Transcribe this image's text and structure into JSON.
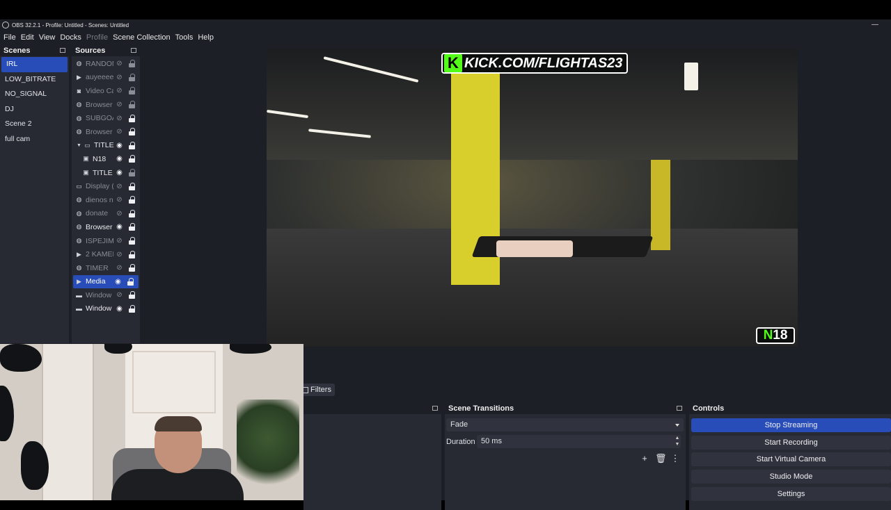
{
  "window": {
    "title": "OBS 32.2.1 - Profile: Untitled - Scenes: Untitled"
  },
  "menu": [
    "File",
    "Edit",
    "View",
    "Docks",
    "Profile",
    "Scene Collection",
    "Tools",
    "Help"
  ],
  "scenes": {
    "header": "Scenes",
    "items": [
      "IRL",
      "LOW_BITRATE",
      "NO_SIGNAL",
      "DJ",
      "Scene 2",
      "full cam"
    ],
    "selected": "IRL"
  },
  "sources": {
    "header": "Sources",
    "items": [
      {
        "name": "RANDOM",
        "icon": "globe-icon",
        "visible": false,
        "locked": false
      },
      {
        "name": "auyeeee",
        "icon": "play-icon",
        "visible": false,
        "locked": false
      },
      {
        "name": "Video Ca",
        "icon": "camera-icon",
        "visible": false,
        "locked": false
      },
      {
        "name": "Browser",
        "icon": "globe-icon",
        "visible": false,
        "locked": false
      },
      {
        "name": "SUBGOA",
        "icon": "globe-icon",
        "visible": false,
        "locked": true
      },
      {
        "name": "Browser",
        "icon": "globe-icon",
        "visible": false,
        "locked": true
      },
      {
        "name": "TITLE",
        "icon": "folder-icon",
        "visible": true,
        "locked": true,
        "expanded": true
      },
      {
        "name": "N18",
        "icon": "image-icon",
        "visible": true,
        "locked": true,
        "child": true
      },
      {
        "name": "TITLE",
        "icon": "image-icon",
        "visible": true,
        "locked": false,
        "child": true
      },
      {
        "name": "Display (",
        "icon": "monitor-icon",
        "visible": false,
        "locked": true
      },
      {
        "name": "dienos n",
        "icon": "globe-icon",
        "visible": false,
        "locked": true
      },
      {
        "name": "donate",
        "icon": "globe-icon",
        "visible": false,
        "locked": true
      },
      {
        "name": "Browser",
        "icon": "globe-icon",
        "visible": true,
        "locked": true
      },
      {
        "name": "ISPEJIMA",
        "icon": "globe-icon",
        "visible": false,
        "locked": true
      },
      {
        "name": "2 KAMEF",
        "icon": "play-icon",
        "visible": false,
        "locked": true
      },
      {
        "name": "TIMER",
        "icon": "globe-icon",
        "visible": false,
        "locked": true
      },
      {
        "name": "Media",
        "icon": "play-icon",
        "visible": true,
        "locked": true,
        "selected": true
      },
      {
        "name": "Window",
        "icon": "window-icon",
        "visible": false,
        "locked": true
      },
      {
        "name": "Window",
        "icon": "window-icon",
        "visible": true,
        "locked": true
      }
    ]
  },
  "preview": {
    "banner_text": "KICK.COM/FLIGHTAS23",
    "banner_k": "K",
    "badge_n": "N",
    "badge_num": "18"
  },
  "filters": {
    "label": "Filters"
  },
  "transitions": {
    "header": "Scene Transitions",
    "selected": "Fade",
    "duration_label": "Duration",
    "duration_value": "50 ms"
  },
  "controls": {
    "header": "Controls",
    "buttons": [
      "Stop Streaming",
      "Start Recording",
      "Start Virtual Camera",
      "Studio Mode",
      "Settings"
    ]
  },
  "colors": {
    "accent": "#284cb8",
    "background": "#1d1f26",
    "dock": "#272a33",
    "kick_green": "#53fc18"
  }
}
